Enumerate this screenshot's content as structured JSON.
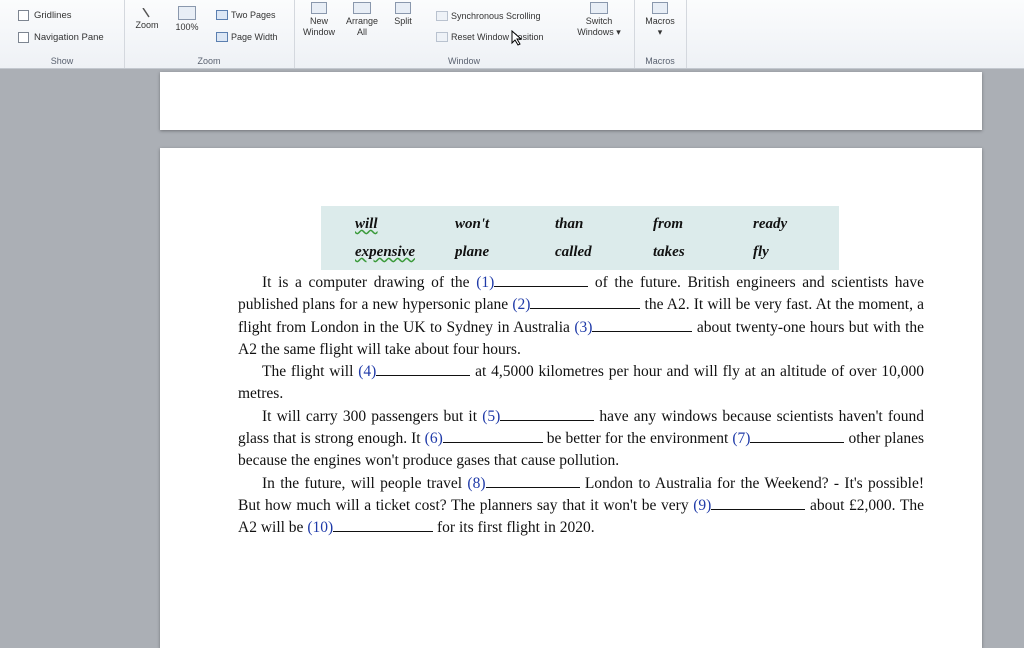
{
  "ribbon": {
    "show": {
      "label": "Show",
      "gridlines": "Gridlines",
      "navigation_pane": "Navigation Pane"
    },
    "zoom": {
      "label": "Zoom",
      "zoom_btn": "Zoom",
      "hundred": "100%",
      "two_pages": "Two Pages",
      "page_width": "Page Width"
    },
    "window": {
      "label": "Window",
      "new_window_1": "New",
      "new_window_2": "Window",
      "arrange_1": "Arrange",
      "arrange_2": "All",
      "split": "Split",
      "sync_scroll": "Synchronous Scrolling",
      "reset_window": "Reset Window Position",
      "switch_1": "Switch",
      "switch_2": "Windows"
    },
    "macros": {
      "label": "Macros",
      "macros_btn": "Macros"
    }
  },
  "word_bank": {
    "row1": [
      "will",
      "won't",
      "than",
      "from",
      "ready"
    ],
    "row2": [
      "expensive",
      "plane",
      "called",
      "takes",
      "fly"
    ]
  },
  "paragraphs": {
    "p1": {
      "t1": "It is a computer drawing of the ",
      "n1": "(1)",
      "t2": " of the future. British engineers and scientists have published plans for a new hypersonic plane ",
      "n2": "(2)",
      "t3": " the A2. It will be very fast. At the moment, a flight from London in the UK to Sydney in Australia ",
      "n3": "(3)",
      "t4": " about twenty-one hours but with the A2 the same flight will take about four hours."
    },
    "p2": {
      "t1": "The flight will ",
      "n4": "(4)",
      "t2": " at 4,5000 kilometres per hour and will fly at an altitude of over 10,000 metres."
    },
    "p3": {
      "t1": "It will carry 300 passengers but it ",
      "n5": "(5)",
      "t2": " have any windows because scientists haven't found glass that is strong enough. It ",
      "n6": "(6)",
      "t3": " be better for the environment ",
      "n7": "(7)",
      "t4": " other planes because the engines won't produce gases that cause pollution."
    },
    "p4": {
      "t1": "In the future, will people travel ",
      "n8": "(8)",
      "t2": " London to Australia for the Weekend? - It's possible! But how much will a ticket cost? The planners say that it won't be very ",
      "n9": "(9)",
      "t3": " about £2,000. The A2 will be ",
      "n10": "(10)",
      "t4": " for its first flight in 2020."
    }
  },
  "colors": {
    "number_blue": "#1f3aa8",
    "word_bank_bg": "#dcebeb",
    "workspace": "#abafb5"
  }
}
